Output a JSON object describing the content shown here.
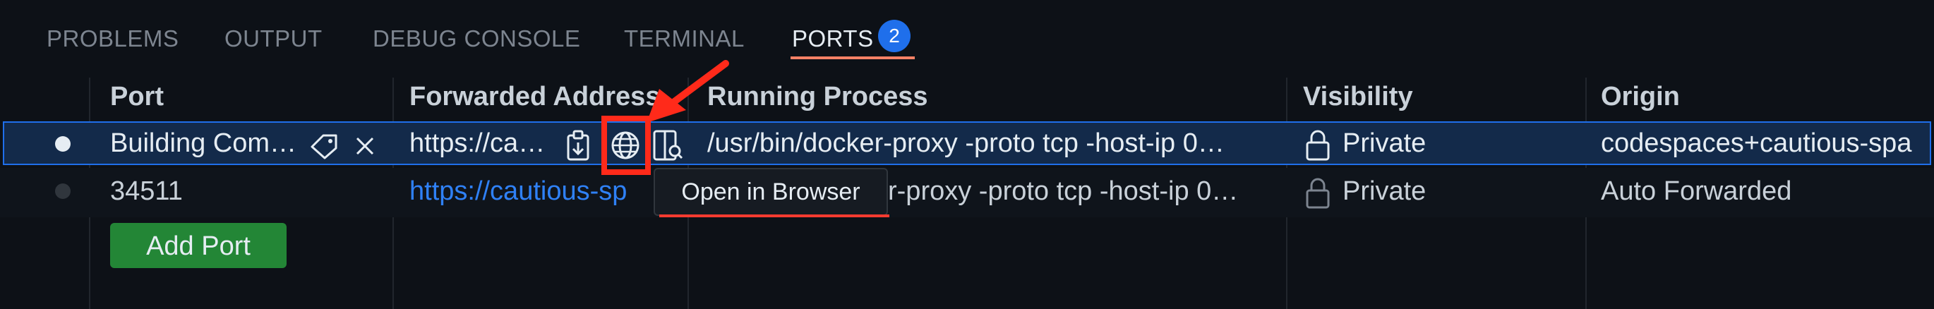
{
  "tabs": [
    {
      "label": "PROBLEMS"
    },
    {
      "label": "OUTPUT"
    },
    {
      "label": "DEBUG CONSOLE"
    },
    {
      "label": "TERMINAL"
    },
    {
      "label": "PORTS",
      "badge": "2",
      "active": true
    }
  ],
  "columns": [
    "Port",
    "Forwarded Address",
    "Running Process",
    "Visibility",
    "Origin"
  ],
  "rows": [
    {
      "port": "Building Com…",
      "address": "https://ca…",
      "process": "/usr/bin/docker-proxy -proto tcp -host-ip 0…",
      "visibility": "Private",
      "origin": "codespaces+cautious-spa"
    },
    {
      "port": "34511",
      "address": "https://cautious-sp",
      "process": "r-proxy -proto tcp -host-ip 0…",
      "visibility": "Private",
      "origin": "Auto Forwarded"
    }
  ],
  "add_port_label": "Add Port",
  "tooltip": "Open in Browser",
  "colors": {
    "accent": "#1f6feb",
    "link": "#2f81f7",
    "button": "#238636",
    "annotation": "#ff2a1a",
    "tab_underline": "#f78166"
  }
}
